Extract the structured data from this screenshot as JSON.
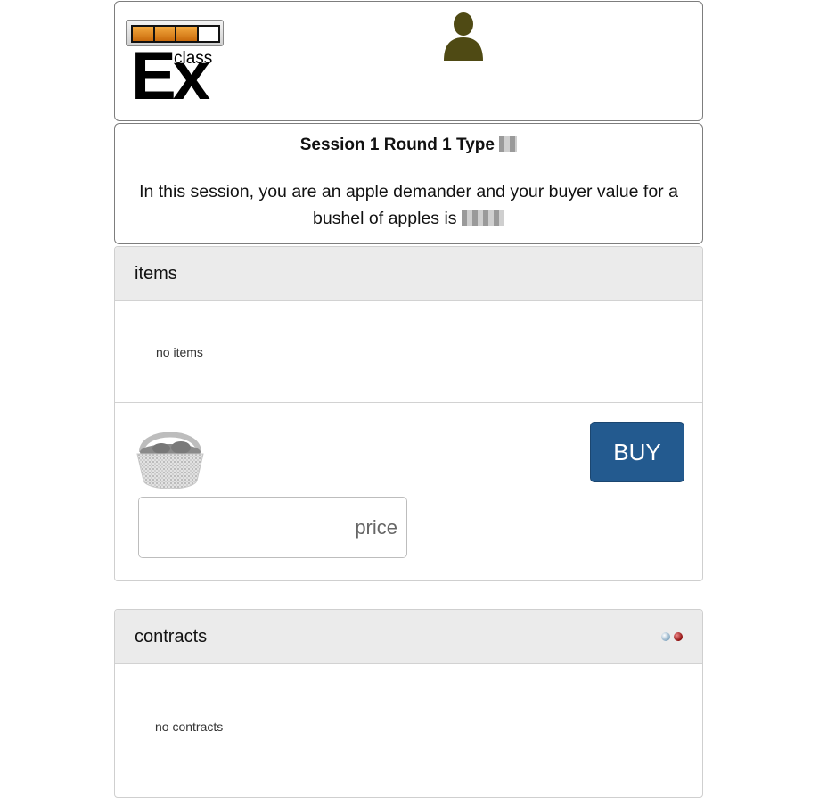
{
  "header": {
    "logo": {
      "progress_filled": 3,
      "progress_total": 4,
      "mark_text": "Ex",
      "mark_superscript": "class"
    },
    "avatar_icon": "user-silhouette-icon",
    "colors": {
      "progress_fill": "#e08a1e",
      "avatar": "#4f4a14"
    }
  },
  "info": {
    "title": "Session 1 Round 1 Type",
    "line": "In this session, you are an apple demander and your buyer value for a bushel of apples is"
  },
  "items": {
    "heading": "items",
    "empty_text": "no items",
    "order": {
      "item_icon": "basket-icon",
      "price_placeholder": "price",
      "currency": "€",
      "buy_label": "BUY"
    },
    "colors": {
      "buy_button": "#235a8f"
    }
  },
  "contracts": {
    "heading": "contracts",
    "empty_text": "no contracts",
    "status_icons": [
      "connection-light-icon",
      "connection-red-icon"
    ]
  }
}
